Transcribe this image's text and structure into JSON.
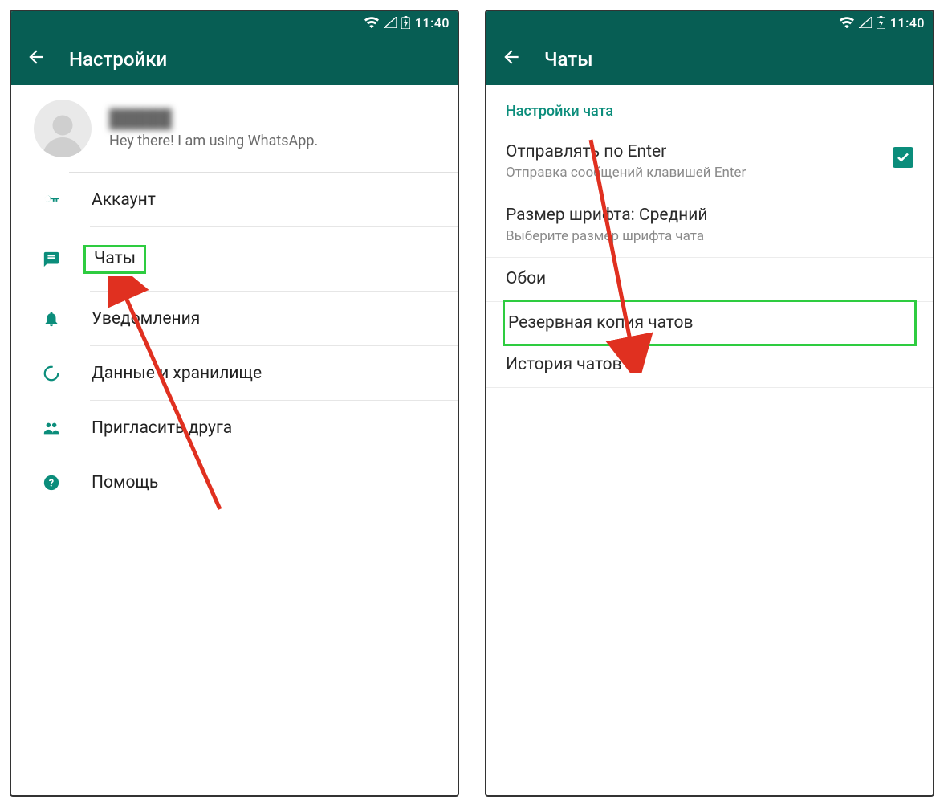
{
  "status": {
    "time": "11:40"
  },
  "left": {
    "title": "Настройки",
    "profile": {
      "name": "█████",
      "status": "Hey there! I am using WhatsApp."
    },
    "menu": [
      {
        "key": "account",
        "label": "Аккаунт"
      },
      {
        "key": "chats",
        "label": "Чаты"
      },
      {
        "key": "notif",
        "label": "Уведомления"
      },
      {
        "key": "data",
        "label": "Данные и хранилище"
      },
      {
        "key": "invite",
        "label": "Пригласить друга"
      },
      {
        "key": "help",
        "label": "Помощь"
      }
    ]
  },
  "right": {
    "title": "Чаты",
    "section": "Настройки чата",
    "items": {
      "enter": {
        "title": "Отправлять по Enter",
        "sub": "Отправка сообщений клавишей Enter",
        "checked": true
      },
      "font": {
        "title": "Размер шрифта: Средний",
        "sub": "Выберите размер шрифта чата"
      },
      "wall": {
        "title": "Обои"
      },
      "backup": {
        "title": "Резервная копия чатов"
      },
      "hist": {
        "title": "История чатов"
      }
    }
  },
  "colors": {
    "brand": "#075e54",
    "accent": "#0b8d7b",
    "highlight": "#2ecc40",
    "arrow": "#e03020"
  }
}
